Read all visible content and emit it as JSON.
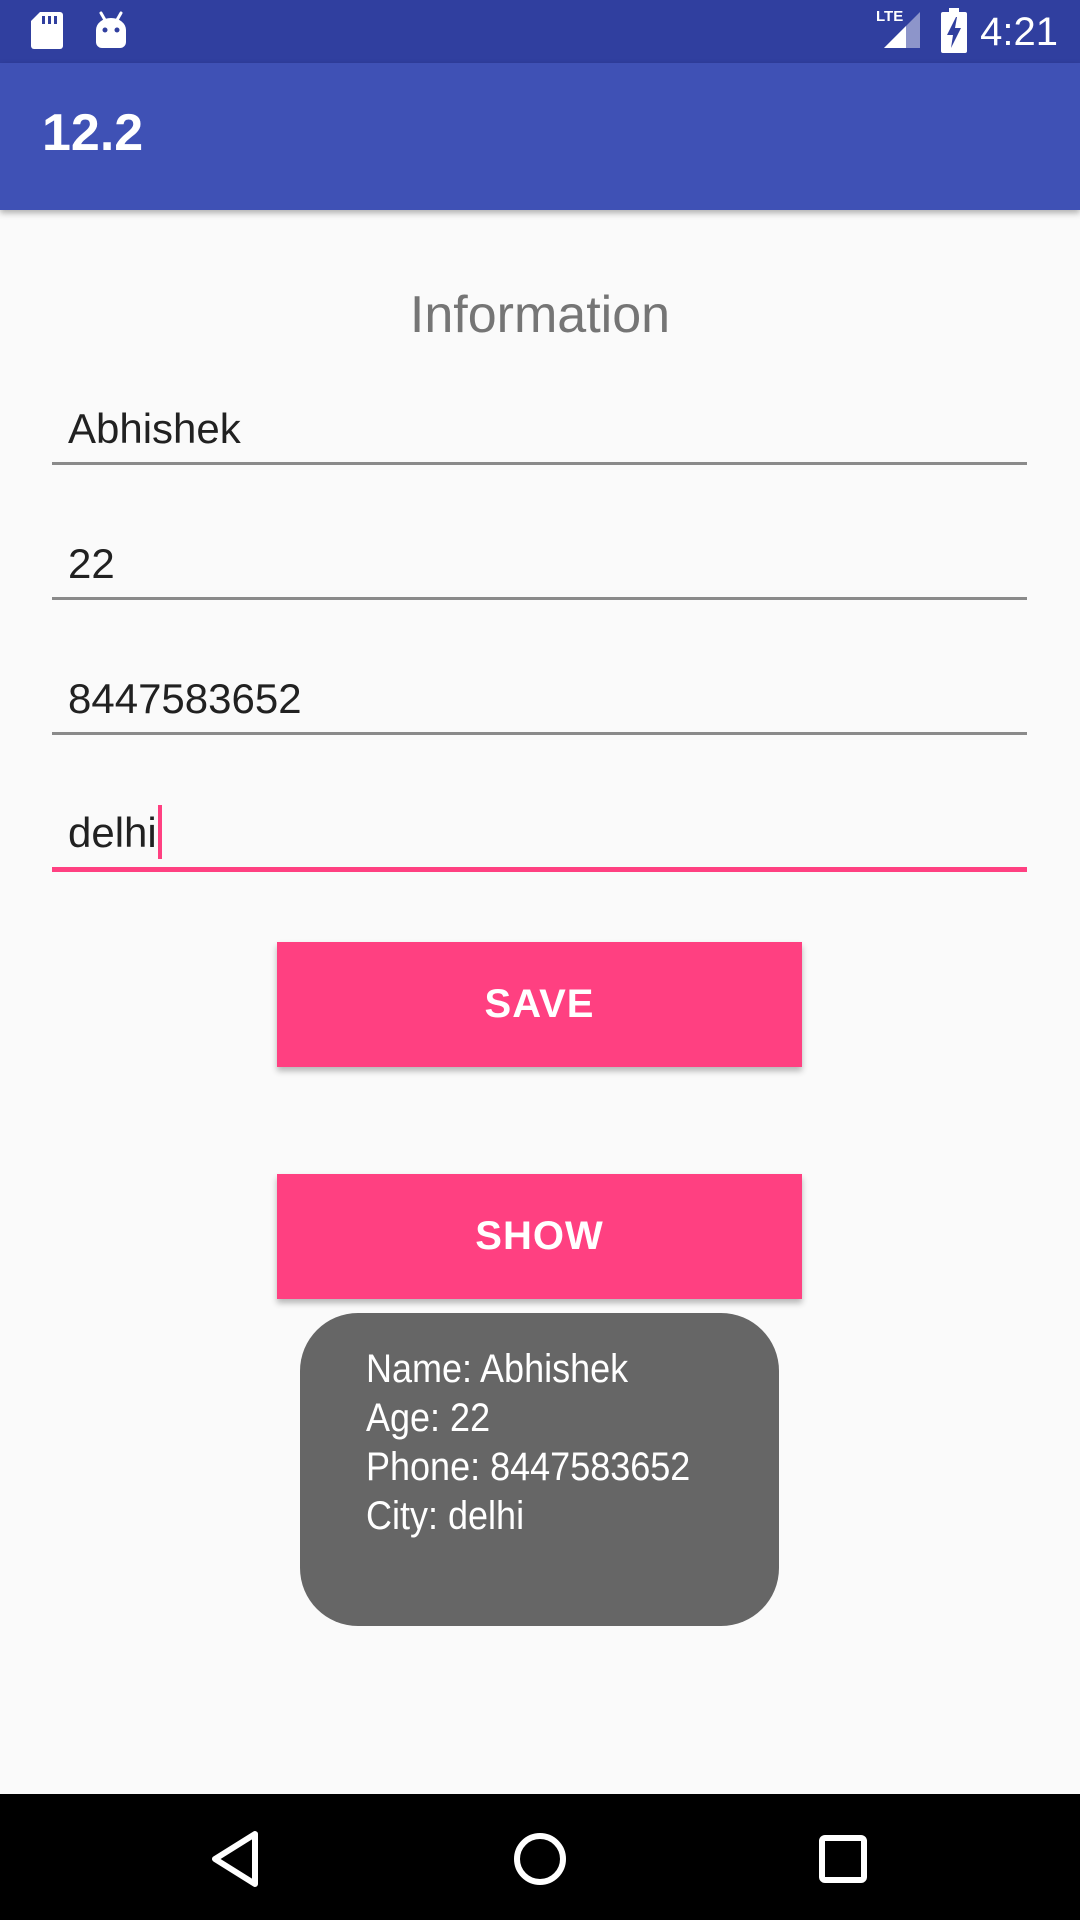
{
  "status_bar": {
    "time": "4:21",
    "network_label": "LTE"
  },
  "app_bar": {
    "title": "12.2"
  },
  "form": {
    "heading": "Information",
    "name_value": "Abhishek",
    "age_value": "22",
    "phone_value": "8447583652",
    "city_value": "delhi"
  },
  "buttons": {
    "save_label": "SAVE",
    "show_label": "SHOW"
  },
  "toast": {
    "line1": "Name: Abhishek",
    "line2": "Age: 22",
    "line3": "Phone: 8447583652",
    "line4": "City: delhi"
  },
  "colors": {
    "status_bar": "#303f9f",
    "app_bar": "#3f51b5",
    "accent": "#ff4081",
    "toast_bg": "#666666",
    "background": "#fafafa"
  },
  "icons": {
    "status_left": [
      "sd-card-icon",
      "android-debug-icon"
    ],
    "status_right": [
      "lte-signal-icon",
      "battery-charging-icon"
    ],
    "nav": [
      "back-icon",
      "home-icon",
      "recents-icon"
    ]
  }
}
